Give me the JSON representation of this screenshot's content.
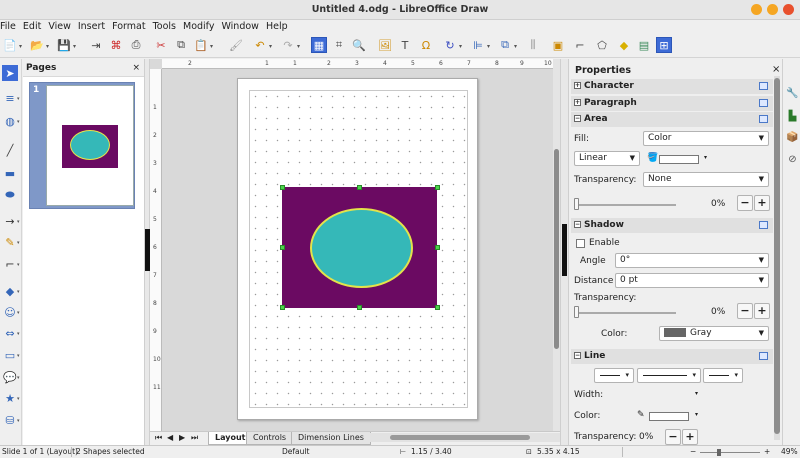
{
  "window": {
    "title": "Untitled 4.odg - LibreOffice Draw"
  },
  "menu": [
    "File",
    "Edit",
    "View",
    "Insert",
    "Format",
    "Tools",
    "Modify",
    "Window",
    "Help"
  ],
  "pages_panel": {
    "title": "Pages",
    "close": "×",
    "thumb_number": "1"
  },
  "ruler": {
    "h_ticks": [
      "2",
      "1",
      "1",
      "2",
      "3",
      "4",
      "5",
      "6",
      "7",
      "8",
      "9",
      "10"
    ],
    "v_ticks": [
      "1",
      "2",
      "3",
      "4",
      "5",
      "6",
      "7",
      "8",
      "9",
      "10",
      "11"
    ]
  },
  "tabs": {
    "nav": [
      "⏮",
      "◀",
      "▶",
      "⏭"
    ],
    "items": [
      "Layout",
      "Controls",
      "Dimension Lines"
    ]
  },
  "sidebar": {
    "title": "Properties",
    "close": "×",
    "sections": {
      "character": "Character",
      "paragraph": "Paragraph",
      "area": "Area",
      "shadow": "Shadow",
      "line": "Line"
    },
    "area": {
      "fill_label": "Fill:",
      "fill_value": "Color",
      "gradient_type": "Linear",
      "transparency_label": "Transparency:",
      "transparency_value": "None",
      "percent": "0%"
    },
    "shadow": {
      "enable_label": "Enable",
      "angle_label": "Angle",
      "angle_value": "0°",
      "distance_label": "Distance",
      "distance_value": "0 pt",
      "transparency_label": "Transparency:",
      "percent": "0%",
      "color_label": "Color:",
      "color_value": "Gray"
    },
    "line": {
      "width_label": "Width:",
      "color_label": "Color:",
      "transparency_label": "Transparency:",
      "percent": "0%"
    }
  },
  "status": {
    "slide": "Slide 1 of 1 (Layout)",
    "selection": "2 Shapes selected",
    "master": "Default",
    "position": "1.15 / 3.40",
    "size": "5.35 x 4.15",
    "zoom": "49%"
  },
  "colors": {
    "rect_fill": "#6b0a62",
    "ellipse_fill": "#35b8b8",
    "ellipse_border": "#e3e34a",
    "handle": "#4cd44c",
    "selected_tool": "#3d6bd6"
  },
  "buttons": {
    "minus": "−",
    "plus": "+"
  }
}
